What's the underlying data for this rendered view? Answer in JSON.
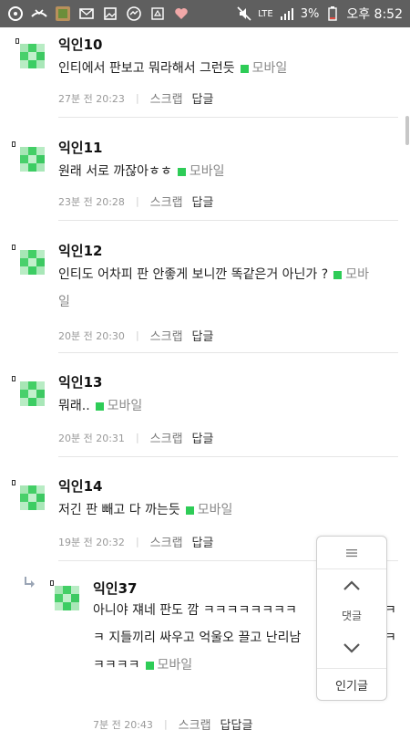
{
  "statusbar": {
    "battery": "3%",
    "time": "오후 8:52",
    "network": "LTE",
    "bg_color": "#5f5f5f"
  },
  "colors": {
    "mobile_green": "#2ecc57",
    "avatar_green": "#3fcf62"
  },
  "comments": [
    {
      "nick": "익인10",
      "text": "인티에서 판보고 뭐라해서 그런듯",
      "text2": "",
      "mobile": "모바일",
      "time": "27분 전 20:23",
      "scrap": "스크랩",
      "reply": "답글"
    },
    {
      "nick": "익인11",
      "text": "원래 서로 까잖아ㅎㅎ",
      "text2": "",
      "mobile": "모바일",
      "time": "23분 전 20:28",
      "scrap": "스크랩",
      "reply": "답글"
    },
    {
      "nick": "익인12",
      "text": "인티도 어차피 판 안좋게 보니깐 똑같은거 아닌가 ?",
      "text2": "일",
      "mobile": "모바",
      "time": "20분 전 20:30",
      "scrap": "스크랩",
      "reply": "답글"
    },
    {
      "nick": "익인13",
      "text": "뭐래..",
      "text2": "",
      "mobile": "모바일",
      "time": "20분 전 20:31",
      "scrap": "스크랩",
      "reply": "답글"
    },
    {
      "nick": "익인14",
      "text": "저긴 판 빼고 다 까는듯",
      "text2": "",
      "mobile": "모바일",
      "time": "19분 전 20:32",
      "scrap": "스크랩",
      "reply": "답글"
    }
  ],
  "subreply": {
    "nick": "익인37",
    "line1": "아니야 쟤네 판도 깜 ㅋㅋㅋㅋㅋㅋㅋㅋ",
    "line1_end": "ㅋ",
    "line2": "ㅋ 지들끼리 싸우고 억울오 끌고 난리남",
    "line2_end": "ㅋ",
    "line3": "ㅋㅋㅋㅋ",
    "mobile": "모바일",
    "time": "7분 전 20:43",
    "scrap": "스크랩",
    "reply": "답답글"
  },
  "floatnav": {
    "label": "댓글",
    "popular": "인기글"
  }
}
